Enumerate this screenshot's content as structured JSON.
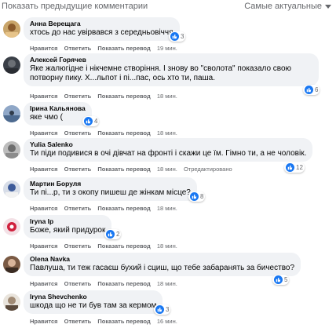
{
  "header": {
    "show_previous": "Показать предыдущие комментарии",
    "sort_label": "Самые актуальные"
  },
  "labels": {
    "like": "Нравится",
    "reply": "Ответить",
    "translate": "Показать перевод",
    "edited": "Отредактировано"
  },
  "colors": {
    "link_gray": "#65676b",
    "bubble_bg": "#f0f2f5",
    "like_blue": "#1877f2"
  },
  "comments": [
    {
      "author": "Анна Верещага",
      "text": "хтось до нас увірвався з середньовіччя",
      "reactions": "3",
      "time": "19 мин."
    },
    {
      "author": "Алексей Горячев",
      "text": "Яке жалюгідне і нікчемне створіння. І знову во \"сволота\" показало свою потворну пику. Х...льпот і пі...пас, ось хто ти, паша.",
      "reactions": "6",
      "time": "18 мин."
    },
    {
      "author": "Ірина Кальянова",
      "text": "яке чмо (",
      "reactions": "4",
      "time": "18 мин."
    },
    {
      "author": "Yulia Salenko",
      "text": "Ти піди подивися в очі дівчат на фронті і скажи це їм. Гімно ти, а не чоловік.",
      "reactions": "12",
      "time": "18 мин."
    },
    {
      "author": "Мартин Боруля",
      "text": "Ти пі...р, ти з окопу пишеш де жінкам місце?",
      "reactions": "8",
      "time": "18 мин."
    },
    {
      "author": "Iryna Ip",
      "text": "Боже, який придурок",
      "reactions": "2",
      "time": "18 мин."
    },
    {
      "author": "Olena Navka",
      "text": "Павлуша, ти теж гасаєш бухий і сциш, що тебе забаранять за бичество?",
      "reactions": "5",
      "time": "18 мин."
    },
    {
      "author": "Iryna Shevchenko",
      "text": "шкода що не ти був там за кермом",
      "reactions": "3",
      "time": "16 мин."
    }
  ]
}
